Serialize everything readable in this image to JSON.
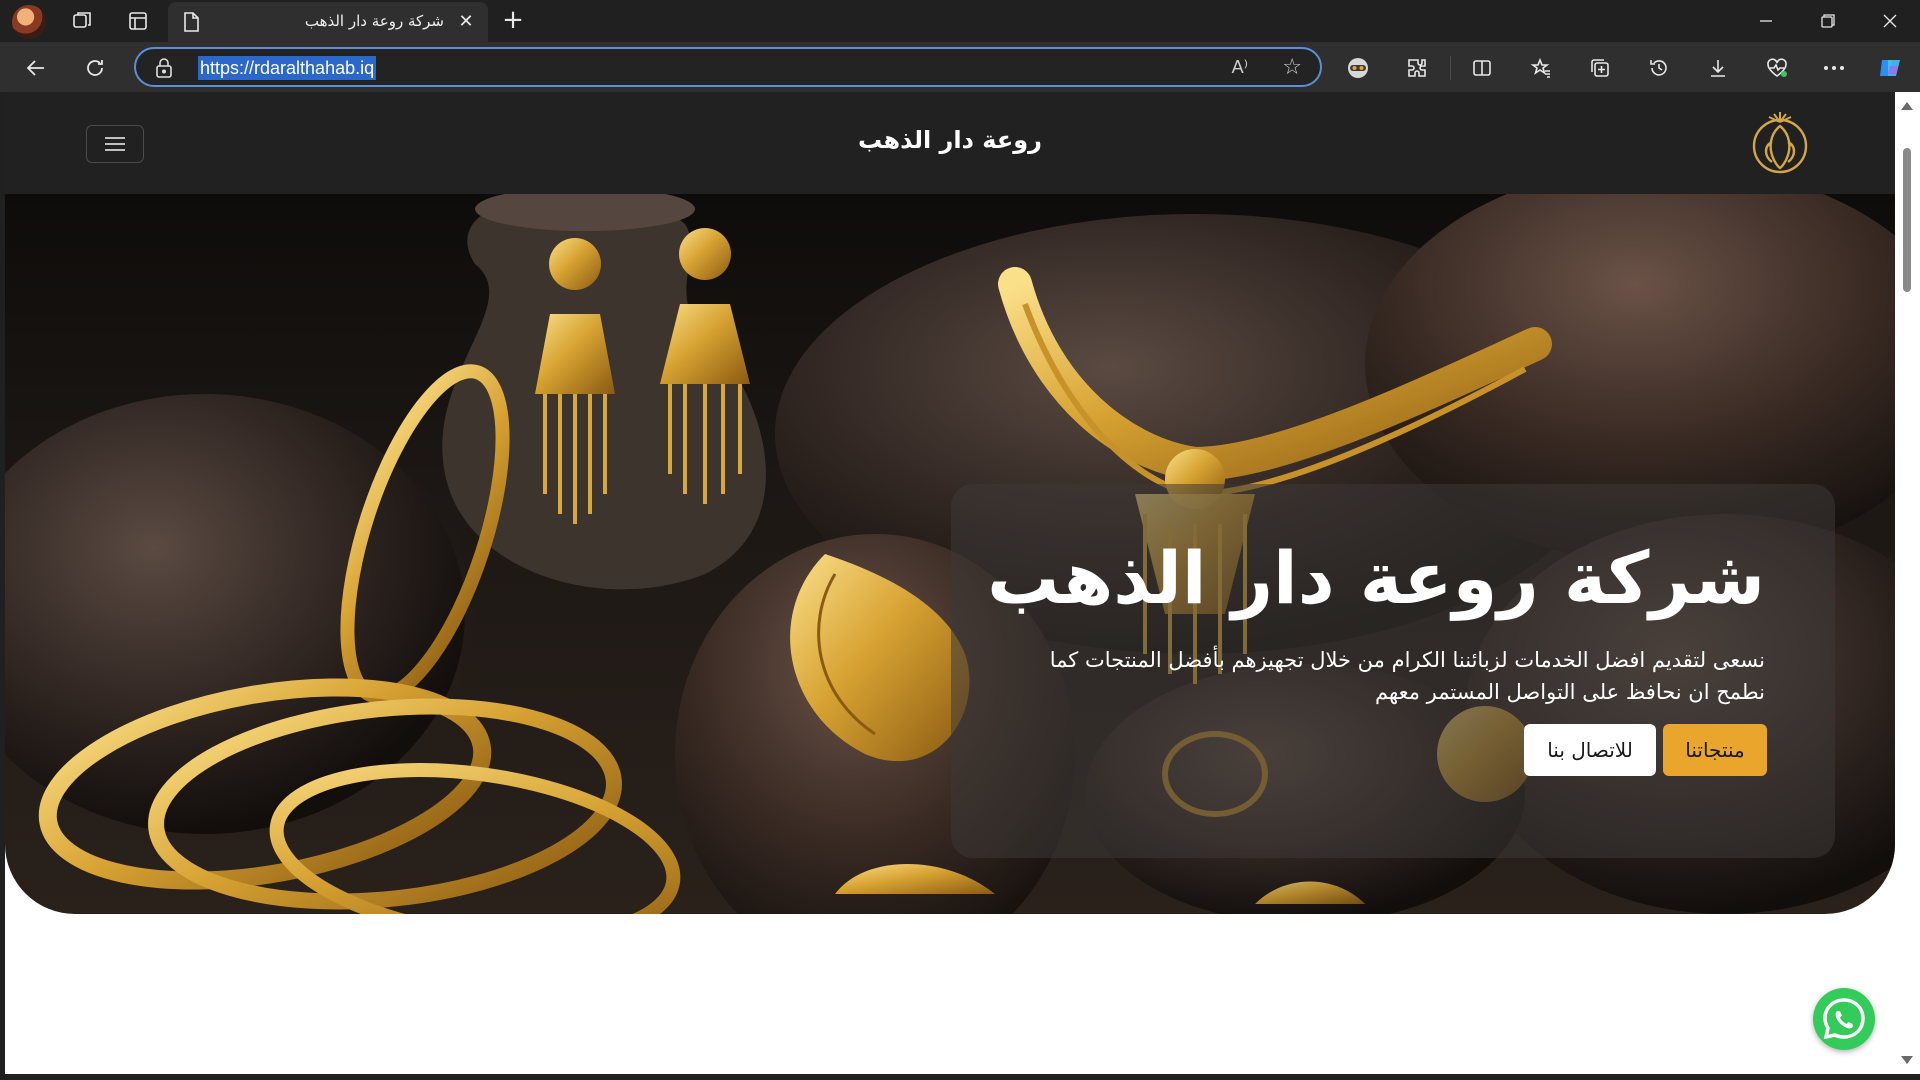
{
  "browser": {
    "tab_title": "شركة روعة دار الذهب",
    "url": "https://rdaralthahab.iq",
    "read_aloud_glyph": "A⁾",
    "icons": [
      "profile-avatar",
      "workspaces-icon",
      "tab-actions-icon",
      "page-icon",
      "close-icon",
      "new-tab-icon",
      "minimize-icon",
      "restore-icon",
      "window-close-icon",
      "back-icon",
      "refresh-icon",
      "lock-icon",
      "read-aloud-icon",
      "favorite-star-icon",
      "extension-mask-icon",
      "extensions-puzzle-icon",
      "split-screen-icon",
      "favorites-icon",
      "collections-icon",
      "history-icon",
      "downloads-icon",
      "heart-health-icon",
      "more-icon",
      "copilot-icon"
    ]
  },
  "site": {
    "header_title": "روعة دار الذهب",
    "hero": {
      "heading": "شركة روعة دار الذهب",
      "subtitle": "نسعى لتقديم افضل الخدمات لزبائننا الكرام من خلال تجهيزهم بأفضل المنتجات كما نطمح ان نحافظ على التواصل المستمر معهم",
      "primary_button": "منتجاتنا",
      "secondary_button": "للاتصال بنا"
    }
  },
  "colors": {
    "accent_gold": "#e9a52c",
    "header_bg": "#212121",
    "whatsapp_green": "#33cc5a",
    "url_highlight": "#2b68c9"
  }
}
